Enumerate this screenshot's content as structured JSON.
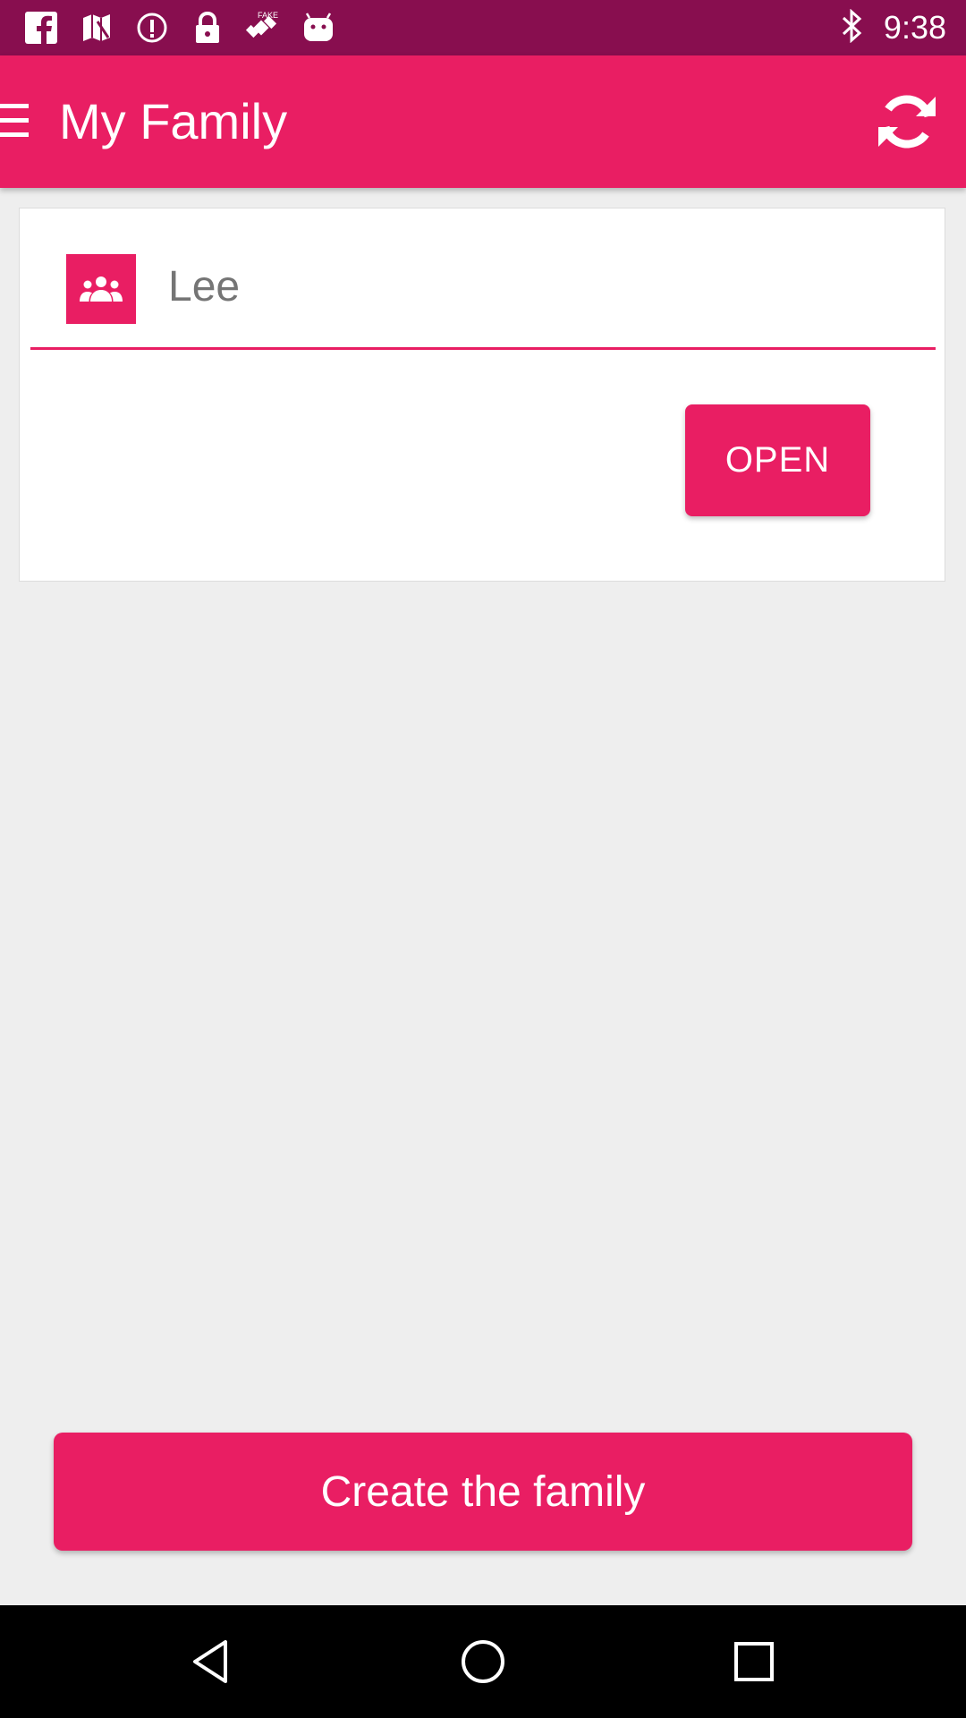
{
  "status_bar": {
    "time": "9:38",
    "left_icons": [
      "facebook-icon",
      "maps-icon",
      "info-circle-icon",
      "lock-icon",
      "fake-gps-icon",
      "android-icon"
    ],
    "right_icons": [
      "bluetooth-icon"
    ],
    "background_color": "#880e4f"
  },
  "app_bar": {
    "title": "My Family",
    "menu_icon": "menu-icon",
    "refresh_icon": "refresh-icon",
    "background_color": "#e91e63"
  },
  "family_card": {
    "icon": "group-icon",
    "family_name": "Lee",
    "open_label": "OPEN"
  },
  "create_button_label": "Create the family",
  "nav_bar": {
    "buttons": [
      "back-icon",
      "home-icon",
      "recents-icon"
    ]
  },
  "colors": {
    "accent": "#e91e63",
    "status": "#880e4f",
    "background": "#eeeeee"
  }
}
